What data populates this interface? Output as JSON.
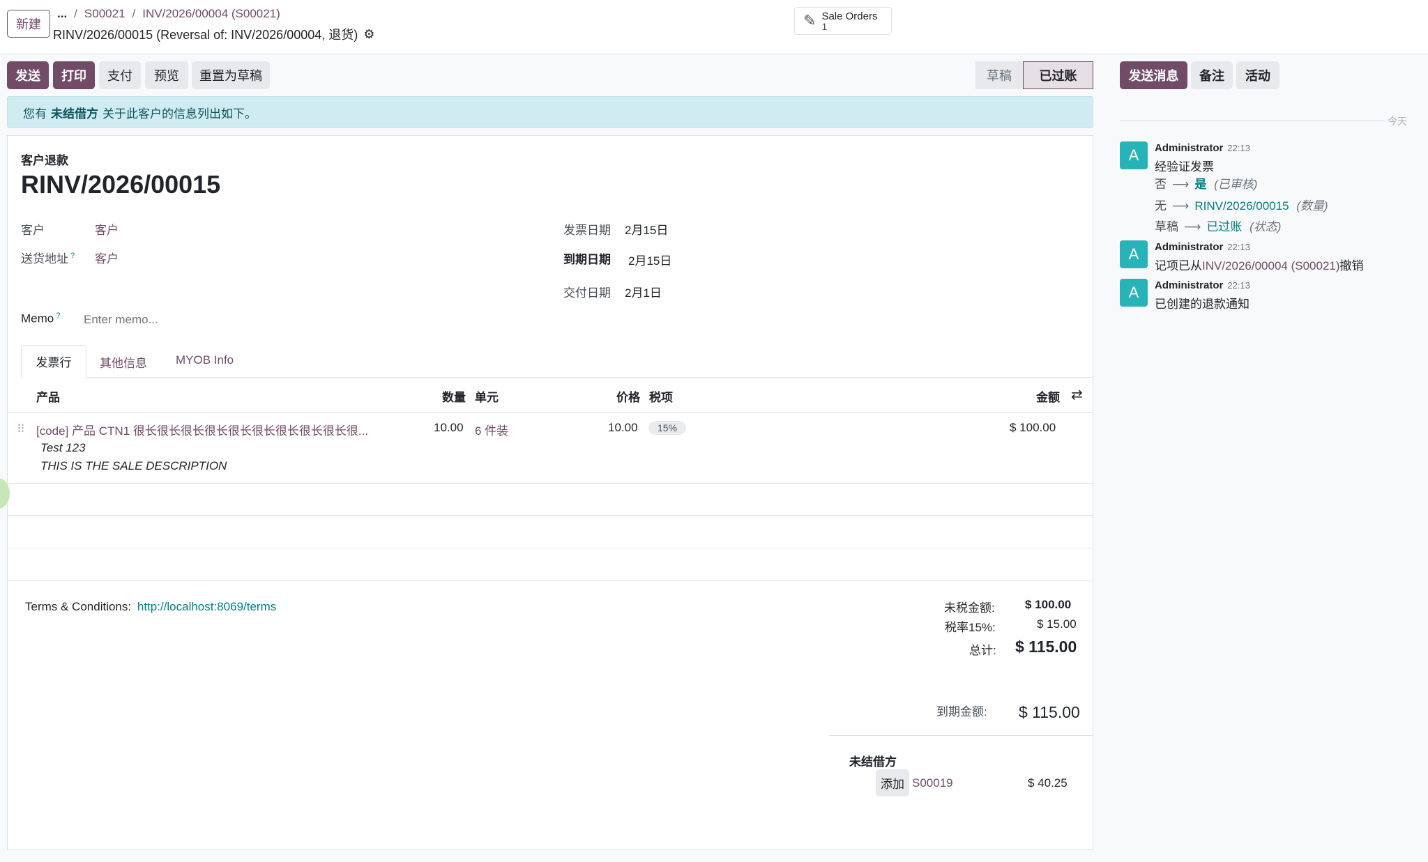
{
  "control": {
    "new_label": "新建",
    "breadcrumb_ellipsis": "...",
    "breadcrumb_sep": "/",
    "breadcrumb_1": "S00021",
    "breadcrumb_2": "INV/2026/00004 (S00021)",
    "title": "RINV/2026/00015 (Reversal of: INV/2026/00004, 退货)",
    "smart_button_label": "Sale Orders",
    "smart_button_count": "1"
  },
  "actions": {
    "send": "发送",
    "print": "打印",
    "pay": "支付",
    "preview": "预览",
    "reset_draft": "重置为草稿"
  },
  "status": {
    "draft": "草稿",
    "posted": "已过账"
  },
  "alert": {
    "prefix": "您有",
    "bold": "未结借方",
    "suffix": "关于此客户的信息列出如下。"
  },
  "form": {
    "type_label": "客户退款",
    "name": "RINV/2026/00015",
    "customer_label": "客户",
    "customer_value": "客户",
    "delivery_label": "送货地址",
    "delivery_help": "?",
    "delivery_value": "客户",
    "invoice_date_label": "发票日期",
    "invoice_date_value": "2月15日",
    "due_date_label": "到期日期",
    "due_date_value": "2月15日",
    "delivery_date_label": "交付日期",
    "delivery_date_value": "2月1日",
    "memo_label": "Memo",
    "memo_help": "?",
    "memo_placeholder": "Enter memo..."
  },
  "tabs": [
    "发票行",
    "其他信息",
    "MYOB Info"
  ],
  "lines": {
    "headers": {
      "product": "产品",
      "quantity": "数量",
      "uom": "单元",
      "price": "价格",
      "taxes": "税项",
      "amount": "金额"
    },
    "rows": [
      {
        "product": "[code] 产品 CTN1 很长很长很长很长很长很长很长很长很长很...",
        "desc1": "Test 123",
        "desc2": "THIS IS THE SALE DESCRIPTION",
        "quantity": "10.00",
        "uom": "6 件装",
        "price": "10.00",
        "tax": "15%",
        "amount": "$ 100.00"
      }
    ]
  },
  "terms": {
    "label": "Terms & Conditions:",
    "link": "http://localhost:8069/terms"
  },
  "totals": {
    "untaxed_label": "未税金额:",
    "untaxed_value": "$ 100.00",
    "tax_label": "税率15%:",
    "tax_value": "$ 15.00",
    "total_label": "总计:",
    "total_value": "$ 115.00",
    "due_label": "到期金额:",
    "due_value": "$ 115.00"
  },
  "outstanding": {
    "title": "未结借方",
    "add_label": "添加",
    "ref": "S00019",
    "amount": "$ 40.25"
  },
  "chatter": {
    "send_message": "发送消息",
    "log_note": "备注",
    "activities": "活动",
    "today": "今天",
    "messages": [
      {
        "avatar": "A",
        "author": "Administrator",
        "time": "22:13",
        "body": "经验证发票",
        "tracking": [
          {
            "old": "否",
            "new": "是",
            "field": "(已审核)"
          },
          {
            "old": "无",
            "new": "RINV/2026/00015",
            "field": "(数量)"
          },
          {
            "old": "草稿",
            "new": "已过账",
            "field": "(状态)"
          }
        ]
      },
      {
        "avatar": "A",
        "author": "Administrator",
        "time": "22:13",
        "body_prefix": "记项已从",
        "body_link": "INV/2026/00004 (S00021)",
        "body_suffix": "撤销"
      },
      {
        "avatar": "A",
        "author": "Administrator",
        "time": "22:13",
        "body": "已创建的退款通知"
      }
    ]
  },
  "colors": {
    "primary": "#714b67",
    "teal": "#017e84",
    "avatar": "#28b3b8",
    "alert_bg": "#d1ecf1"
  }
}
